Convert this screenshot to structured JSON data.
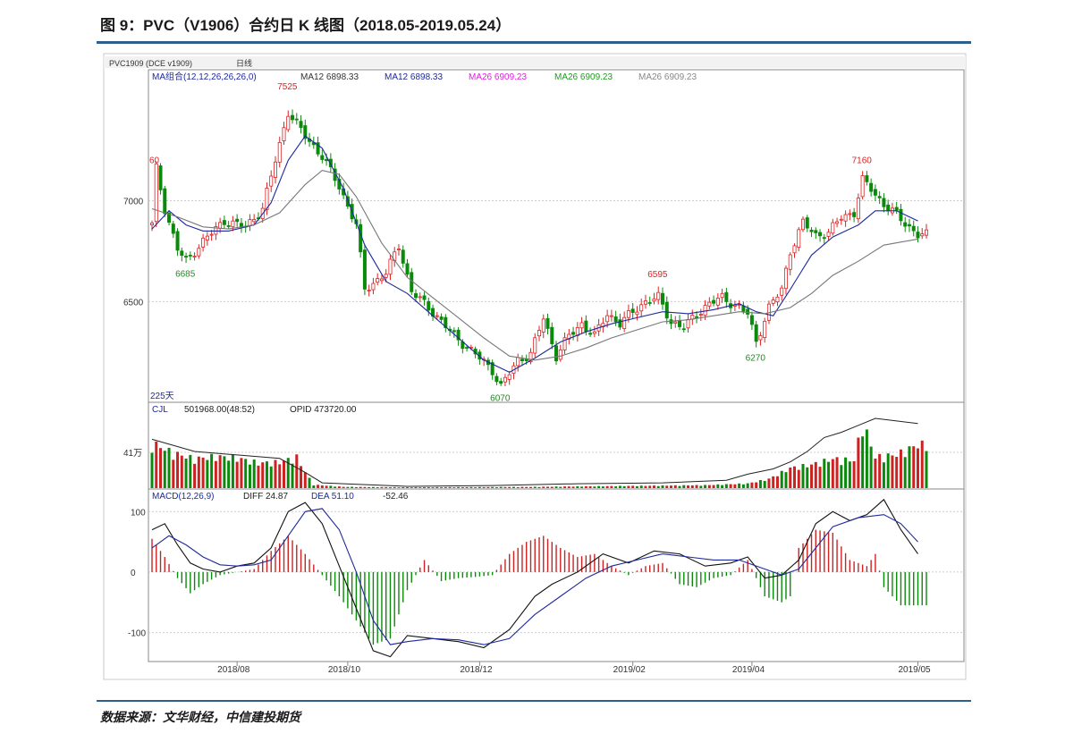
{
  "figure": {
    "title": "图 9：PVC（V1906）合约日 K 线图（2018.05-2019.05.24）",
    "source": "数据来源：文华财经，中信建投期货"
  },
  "chart_data": {
    "type": "candlestick",
    "header": {
      "symbol_label": "PVC1909 (DCE v1909)",
      "period_label": "日线"
    },
    "ma_legend": [
      {
        "text": "MA组合(12,12,26,26,26,0)",
        "color": "#1e2a9c"
      },
      {
        "text": "MA12 6898.33",
        "color": "#333333"
      },
      {
        "text": "MA12 6898.33",
        "color": "#1e2a9c"
      },
      {
        "text": "MA26 6909.23",
        "color": "#e020e0"
      },
      {
        "text": "MA26 6909.23",
        "color": "#229922"
      },
      {
        "text": "MA26 6909.23",
        "color": "#888888"
      }
    ],
    "price_axis": {
      "ticks": [
        7000,
        6500
      ],
      "range": [
        6010,
        7640
      ]
    },
    "price_annotations": [
      {
        "text": "60",
        "bar": 1,
        "value": 7160,
        "color": "#dd2222"
      },
      {
        "text": "7525",
        "bar": 32,
        "value": 7525,
        "color": "#dd2222"
      },
      {
        "text": "6685",
        "bar": 8,
        "value": 6685,
        "color": "#228822"
      },
      {
        "text": "6070",
        "bar": 82,
        "value": 6070,
        "color": "#228822"
      },
      {
        "text": "6595",
        "bar": 119,
        "value": 6595,
        "color": "#dd2222"
      },
      {
        "text": "6270",
        "bar": 142,
        "value": 6270,
        "color": "#228822"
      },
      {
        "text": "7160",
        "bar": 167,
        "value": 7160,
        "color": "#dd2222"
      }
    ],
    "bar_count_label": "225天",
    "price_points": [
      [
        0,
        6880
      ],
      [
        1,
        7160
      ],
      [
        3,
        6960
      ],
      [
        6,
        6760
      ],
      [
        8,
        6700
      ],
      [
        12,
        6800
      ],
      [
        17,
        6900
      ],
      [
        22,
        6870
      ],
      [
        26,
        6960
      ],
      [
        29,
        7200
      ],
      [
        32,
        7440
      ],
      [
        36,
        7320
      ],
      [
        40,
        7220
      ],
      [
        44,
        7070
      ],
      [
        48,
        6880
      ],
      [
        50,
        6560
      ],
      [
        55,
        6640
      ],
      [
        58,
        6780
      ],
      [
        61,
        6550
      ],
      [
        66,
        6450
      ],
      [
        71,
        6330
      ],
      [
        76,
        6240
      ],
      [
        80,
        6160
      ],
      [
        82,
        6080
      ],
      [
        86,
        6210
      ],
      [
        89,
        6240
      ],
      [
        92,
        6420
      ],
      [
        95,
        6230
      ],
      [
        98,
        6330
      ],
      [
        101,
        6390
      ],
      [
        104,
        6330
      ],
      [
        107,
        6440
      ],
      [
        110,
        6390
      ],
      [
        113,
        6450
      ],
      [
        116,
        6500
      ],
      [
        119,
        6520
      ],
      [
        122,
        6400
      ],
      [
        125,
        6370
      ],
      [
        128,
        6440
      ],
      [
        131,
        6490
      ],
      [
        134,
        6520
      ],
      [
        138,
        6470
      ],
      [
        140,
        6440
      ],
      [
        142,
        6300
      ],
      [
        145,
        6470
      ],
      [
        148,
        6560
      ],
      [
        150,
        6750
      ],
      [
        153,
        6890
      ],
      [
        156,
        6830
      ],
      [
        159,
        6840
      ],
      [
        162,
        6920
      ],
      [
        165,
        6940
      ],
      [
        167,
        7100
      ],
      [
        169,
        7060
      ],
      [
        172,
        6980
      ],
      [
        175,
        6930
      ],
      [
        178,
        6870
      ],
      [
        180,
        6830
      ]
    ],
    "ma12_points": [
      [
        0,
        6860
      ],
      [
        4,
        6950
      ],
      [
        8,
        6880
      ],
      [
        12,
        6850
      ],
      [
        18,
        6850
      ],
      [
        24,
        6880
      ],
      [
        28,
        6990
      ],
      [
        32,
        7200
      ],
      [
        36,
        7320
      ],
      [
        40,
        7260
      ],
      [
        45,
        7060
      ],
      [
        50,
        6780
      ],
      [
        55,
        6600
      ],
      [
        60,
        6540
      ],
      [
        66,
        6430
      ],
      [
        72,
        6320
      ],
      [
        78,
        6210
      ],
      [
        84,
        6150
      ],
      [
        90,
        6220
      ],
      [
        96,
        6300
      ],
      [
        102,
        6350
      ],
      [
        108,
        6390
      ],
      [
        114,
        6420
      ],
      [
        120,
        6450
      ],
      [
        126,
        6440
      ],
      [
        132,
        6460
      ],
      [
        138,
        6490
      ],
      [
        142,
        6450
      ],
      [
        146,
        6430
      ],
      [
        150,
        6560
      ],
      [
        155,
        6730
      ],
      [
        160,
        6820
      ],
      [
        166,
        6880
      ],
      [
        170,
        6950
      ],
      [
        175,
        6950
      ],
      [
        180,
        6900
      ]
    ],
    "ma26_points": [
      [
        0,
        6960
      ],
      [
        6,
        6920
      ],
      [
        12,
        6870
      ],
      [
        18,
        6860
      ],
      [
        24,
        6880
      ],
      [
        30,
        6940
      ],
      [
        36,
        7080
      ],
      [
        40,
        7150
      ],
      [
        44,
        7130
      ],
      [
        48,
        7020
      ],
      [
        54,
        6790
      ],
      [
        60,
        6620
      ],
      [
        66,
        6520
      ],
      [
        72,
        6420
      ],
      [
        78,
        6320
      ],
      [
        84,
        6230
      ],
      [
        90,
        6210
      ],
      [
        96,
        6230
      ],
      [
        102,
        6270
      ],
      [
        108,
        6320
      ],
      [
        114,
        6360
      ],
      [
        120,
        6400
      ],
      [
        126,
        6410
      ],
      [
        132,
        6430
      ],
      [
        138,
        6450
      ],
      [
        144,
        6440
      ],
      [
        150,
        6470
      ],
      [
        155,
        6540
      ],
      [
        160,
        6630
      ],
      [
        166,
        6700
      ],
      [
        172,
        6780
      ],
      [
        180,
        6810
      ]
    ],
    "volume": {
      "label": "CJL",
      "readout": "501968.00(48:52)",
      "opid_readout": "OPID 473720.00",
      "tick_label": "41万",
      "tick_value": 410000,
      "range": [
        0,
        820000
      ],
      "bars": [
        [
          0,
          540000,
          1
        ],
        [
          5,
          420000,
          0
        ],
        [
          10,
          350000,
          1
        ],
        [
          15,
          380000,
          0
        ],
        [
          20,
          360000,
          1
        ],
        [
          25,
          300000,
          0
        ],
        [
          30,
          310000,
          1
        ],
        [
          34,
          370000,
          0
        ],
        [
          36,
          190000,
          1
        ],
        [
          38,
          40000,
          0
        ],
        [
          45,
          15000,
          1
        ],
        [
          60,
          10000,
          0
        ],
        [
          75,
          12000,
          1
        ],
        [
          90,
          15000,
          0
        ],
        [
          100,
          20000,
          1
        ],
        [
          110,
          25000,
          0
        ],
        [
          120,
          30000,
          1
        ],
        [
          130,
          35000,
          0
        ],
        [
          140,
          55000,
          1
        ],
        [
          145,
          110000,
          0
        ],
        [
          150,
          240000,
          1
        ],
        [
          155,
          280000,
          0
        ],
        [
          160,
          350000,
          1
        ],
        [
          165,
          330000,
          0
        ],
        [
          167,
          790000,
          1
        ],
        [
          170,
          370000,
          0
        ],
        [
          175,
          400000,
          1
        ],
        [
          180,
          520000,
          1
        ]
      ],
      "opid_points": [
        [
          0,
          560000
        ],
        [
          10,
          420000
        ],
        [
          20,
          380000
        ],
        [
          30,
          340000
        ],
        [
          36,
          180000
        ],
        [
          40,
          60000
        ],
        [
          60,
          20000
        ],
        [
          80,
          30000
        ],
        [
          100,
          50000
        ],
        [
          120,
          60000
        ],
        [
          135,
          90000
        ],
        [
          140,
          160000
        ],
        [
          146,
          220000
        ],
        [
          150,
          300000
        ],
        [
          154,
          420000
        ],
        [
          158,
          580000
        ],
        [
          162,
          640000
        ],
        [
          166,
          720000
        ],
        [
          170,
          800000
        ],
        [
          175,
          770000
        ],
        [
          180,
          740000
        ]
      ]
    },
    "macd": {
      "label": "MACD(12,26,9)",
      "diff_readout": "DIFF 24.87",
      "dea_readout": "DEA 51.10",
      "macd_readout": "-52.46",
      "ticks": [
        100,
        0,
        -100
      ],
      "range": [
        -145,
        130
      ],
      "diff_points": [
        [
          0,
          70
        ],
        [
          3,
          80
        ],
        [
          6,
          45
        ],
        [
          9,
          15
        ],
        [
          12,
          5
        ],
        [
          16,
          0
        ],
        [
          20,
          10
        ],
        [
          24,
          15
        ],
        [
          28,
          40
        ],
        [
          32,
          100
        ],
        [
          36,
          115
        ],
        [
          40,
          80
        ],
        [
          44,
          10
        ],
        [
          48,
          -60
        ],
        [
          52,
          -130
        ],
        [
          56,
          -140
        ],
        [
          60,
          -105
        ],
        [
          66,
          -110
        ],
        [
          72,
          -115
        ],
        [
          78,
          -125
        ],
        [
          84,
          -95
        ],
        [
          90,
          -40
        ],
        [
          94,
          -20
        ],
        [
          100,
          0
        ],
        [
          106,
          30
        ],
        [
          112,
          15
        ],
        [
          118,
          35
        ],
        [
          124,
          30
        ],
        [
          130,
          10
        ],
        [
          136,
          15
        ],
        [
          140,
          25
        ],
        [
          144,
          -10
        ],
        [
          148,
          -5
        ],
        [
          152,
          20
        ],
        [
          156,
          80
        ],
        [
          160,
          100
        ],
        [
          164,
          85
        ],
        [
          168,
          95
        ],
        [
          172,
          120
        ],
        [
          176,
          70
        ],
        [
          180,
          30
        ]
      ],
      "dea_points": [
        [
          0,
          40
        ],
        [
          4,
          60
        ],
        [
          8,
          45
        ],
        [
          12,
          25
        ],
        [
          16,
          12
        ],
        [
          20,
          10
        ],
        [
          24,
          12
        ],
        [
          28,
          20
        ],
        [
          32,
          60
        ],
        [
          36,
          100
        ],
        [
          40,
          105
        ],
        [
          44,
          70
        ],
        [
          48,
          0
        ],
        [
          52,
          -80
        ],
        [
          56,
          -120
        ],
        [
          60,
          -115
        ],
        [
          66,
          -110
        ],
        [
          72,
          -112
        ],
        [
          78,
          -120
        ],
        [
          84,
          -110
        ],
        [
          90,
          -70
        ],
        [
          96,
          -40
        ],
        [
          102,
          -10
        ],
        [
          108,
          10
        ],
        [
          114,
          20
        ],
        [
          120,
          30
        ],
        [
          126,
          25
        ],
        [
          132,
          20
        ],
        [
          138,
          20
        ],
        [
          144,
          5
        ],
        [
          148,
          -5
        ],
        [
          152,
          5
        ],
        [
          156,
          40
        ],
        [
          160,
          75
        ],
        [
          166,
          90
        ],
        [
          172,
          95
        ],
        [
          176,
          80
        ],
        [
          180,
          50
        ]
      ],
      "hist_bars": [
        [
          0,
          55
        ],
        [
          3,
          25
        ],
        [
          6,
          -10
        ],
        [
          9,
          -35
        ],
        [
          12,
          -20
        ],
        [
          16,
          -5
        ],
        [
          20,
          0
        ],
        [
          24,
          5
        ],
        [
          28,
          35
        ],
        [
          32,
          60
        ],
        [
          36,
          30
        ],
        [
          40,
          -5
        ],
        [
          44,
          -40
        ],
        [
          48,
          -80
        ],
        [
          52,
          -120
        ],
        [
          56,
          -110
        ],
        [
          60,
          -30
        ],
        [
          64,
          20
        ],
        [
          68,
          -15
        ],
        [
          72,
          -10
        ],
        [
          76,
          -8
        ],
        [
          80,
          -5
        ],
        [
          84,
          30
        ],
        [
          88,
          50
        ],
        [
          92,
          60
        ],
        [
          96,
          40
        ],
        [
          100,
          25
        ],
        [
          104,
          30
        ],
        [
          108,
          10
        ],
        [
          112,
          -5
        ],
        [
          116,
          10
        ],
        [
          120,
          15
        ],
        [
          124,
          -20
        ],
        [
          128,
          -25
        ],
        [
          132,
          -10
        ],
        [
          136,
          -5
        ],
        [
          140,
          20
        ],
        [
          144,
          -40
        ],
        [
          148,
          -50
        ],
        [
          150,
          -40
        ],
        [
          152,
          40
        ],
        [
          156,
          70
        ],
        [
          160,
          65
        ],
        [
          164,
          20
        ],
        [
          168,
          10
        ],
        [
          170,
          30
        ],
        [
          172,
          -25
        ],
        [
          176,
          -55
        ],
        [
          180,
          -55
        ]
      ]
    },
    "x_axis": {
      "labels": [
        {
          "text": "2018/08",
          "bar": 20
        },
        {
          "text": "2018/10",
          "bar": 46
        },
        {
          "text": "2018/12",
          "bar": 77
        },
        {
          "text": "2019/02",
          "bar": 113
        },
        {
          "text": "2019/04",
          "bar": 141
        },
        {
          "text": "2019/05",
          "bar": 180
        }
      ]
    },
    "bar_range": [
      0,
      182
    ]
  }
}
